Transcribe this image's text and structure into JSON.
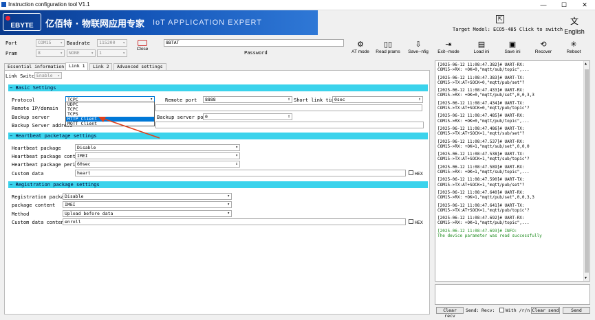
{
  "window": {
    "title": "Instruction configuration tool V1.1",
    "min": "—",
    "max": "☐",
    "close": "✕"
  },
  "banner": {
    "logo_text": "EBYTE",
    "cn_name": "亿佰特 · 物联网应用专家",
    "en_name": "IoT APPLICATION EXPERT"
  },
  "target_model": "Target Model: ECO5-485 Click to switch",
  "language": "English",
  "conn": {
    "port_label": "Port",
    "port_value": "COM15",
    "baud_label": "Baudrate",
    "baud_value": "115200",
    "pram_label": "Pram",
    "pram_value1": "8",
    "pram_value2": "NONE",
    "pram_value3": "1",
    "close_label": "Close",
    "password_value": "8BTAT",
    "password_label": "Password"
  },
  "toolbar": [
    {
      "label": "AT mode",
      "icon": "⚙"
    },
    {
      "label": "Read prams",
      "icon": "▯▯"
    },
    {
      "label": "Save--nfig",
      "icon": "⇩"
    },
    {
      "label": "Exit--mode",
      "icon": "⇥"
    },
    {
      "label": "Load ini",
      "icon": "▤"
    },
    {
      "label": "Save ini",
      "icon": "▣"
    },
    {
      "label": "Recover",
      "icon": "⟲"
    },
    {
      "label": "Reboot",
      "icon": "✳"
    }
  ],
  "tabs": [
    "Essential information",
    "Link 1",
    "Link 2",
    "Advanced settings"
  ],
  "link_switch": {
    "label": "Link Switch",
    "value": "Enable"
  },
  "basic": {
    "title": "Basic Settings",
    "protocol_label": "Protocol",
    "protocol_value": "TCPC",
    "remote_port_label": "Remote port",
    "remote_port_value": "8888",
    "short_link_label": "Short link time",
    "short_link_value": "0sec",
    "remote_ip_label": "Remote IP/domain",
    "backup_server_label": "Backup server",
    "backup_port_label": "Backup server port",
    "backup_port_value": "0",
    "backup_addr_label": "Backup Server address",
    "options": [
      "UDPC",
      "TCPC",
      "TCPS",
      "HTTP Client",
      "MQTT Client"
    ],
    "highlighted_option": "HTTP Client"
  },
  "heartbeat": {
    "title": "Heartbeat packetage settings",
    "pkg_label": "Heartbeat package",
    "pkg_value": "Disable",
    "content_label": "Heartbeat package content",
    "content_value": "IMEI",
    "period_label": "Heartbeat package period",
    "period_value": "60sec",
    "custom_label": "Custom data",
    "custom_value": "heart",
    "hex_label": "HEX"
  },
  "registration": {
    "title": "Registration package settings",
    "pkg_label": "Registration package",
    "pkg_value": "Disable",
    "content_label": "package content",
    "content_value": "IMEI",
    "method_label": "Method",
    "method_value": "Upload before data",
    "custom_label": "Custom data content",
    "custom_value": "enroll",
    "hex_label": "HEX"
  },
  "log": [
    {
      "l1": "[2025-06-12 11:08:47.382]# UART-RX:",
      "l2": "COM15->RX: +OK=0,\"mqtt/sub/topic\",..."
    },
    {
      "l1": "[2025-06-12 11:08:47.383]# UART-TX:",
      "l2": "COM15->TX:AT+SOCK=0,\"mqtt/pub/set\"?"
    },
    {
      "l1": "[2025-06-12 11:08:47.433]# UART-RX:",
      "l2": "COM15->RX: +OK=0,\"mqtt/pub/set\",0,0,3,3"
    },
    {
      "l1": "[2025-06-12 11:08:47.434]# UART-TX:",
      "l2": "COM15->TX:AT+SOCK=0,\"mqtt/pub/topic\"?"
    },
    {
      "l1": "[2025-06-12 11:08:47.485]# UART-RX:",
      "l2": "COM15->RX: +OK=0,\"mqtt/pub/topic\",..."
    },
    {
      "l1": "[2025-06-12 11:08:47.486]# UART-TX:",
      "l2": "COM15->TX:AT+SOCK=1,\"mqtt/sub/set\"?"
    },
    {
      "l1": "[2025-06-12 11:08:47.537]# UART-RX:",
      "l2": "COM15->RX: +OK=1,\"mqtt/sub/set\",0,0,0"
    },
    {
      "l1": "[2025-06-12 11:08:47.538]# UART-TX:",
      "l2": "COM15->TX:AT+SOCK=1,\"mqtt/sub/topic\"?"
    },
    {
      "l1": "[2025-06-12 11:08:47.589]# UART-RX:",
      "l2": "COM15->RX: +OK=1,\"mqtt/sub/topic\",..."
    },
    {
      "l1": "[2025-06-12 11:08:47.590]# UART-TX:",
      "l2": "COM15->TX:AT+SOCK=1,\"mqtt/pub/set\"?"
    },
    {
      "l1": "[2025-06-12 11:08:47.640]# UART-RX:",
      "l2": "COM15->RX: +OK=1,\"mqtt/pub/set\",0,0,3,3"
    },
    {
      "l1": "[2025-06-12 11:08:47.641]# UART-TX:",
      "l2": "COM15->TX:AT+SOCK=1,\"mqtt/pub/topic\"?"
    },
    {
      "l1": "[2025-06-12 11:08:47.692]# UART-RX:",
      "l2": "COM15->RX: +OK=1,\"mqtt/pub/topic\",..."
    }
  ],
  "log_info": {
    "l1": "[2025-06-12 11:08:47.693]# INFO:",
    "l2": "The device parameter was read successfully"
  },
  "bottom": {
    "clear_recv": "Clear recv",
    "send_label": "Send:",
    "recv_label": "Recv:",
    "with_rn": "With /r/n",
    "clear_send": "Clear send",
    "send": "Send"
  },
  "colors": {
    "banner": "#1455b8",
    "section": "#3bd3ec",
    "arrow": "#e0401a",
    "highlight": "#0078d7"
  }
}
